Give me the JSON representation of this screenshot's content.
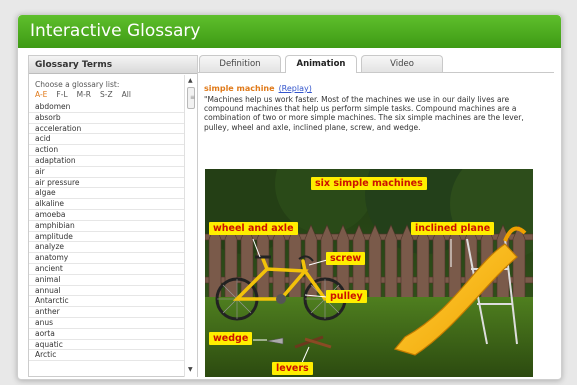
{
  "window": {
    "title": "Interactive Glossary"
  },
  "left_panel": {
    "header": "Glossary Terms",
    "choose_label": "Choose a glossary list:",
    "ranges": [
      "A-E",
      "F-L",
      "M-R",
      "S-Z",
      "All"
    ],
    "active_range": "A-E",
    "terms": [
      "abdomen",
      "absorb",
      "acceleration",
      "acid",
      "action",
      "adaptation",
      "air",
      "air pressure",
      "algae",
      "alkaline",
      "amoeba",
      "amphibian",
      "amplitude",
      "analyze",
      "anatomy",
      "ancient",
      "animal",
      "annual",
      "Antarctic",
      "anther",
      "anus",
      "aorta",
      "aquatic",
      "Arctic"
    ]
  },
  "tabs": [
    {
      "label": "Definition",
      "active": false
    },
    {
      "label": "Animation",
      "active": true
    },
    {
      "label": "Video",
      "active": false
    }
  ],
  "content": {
    "term": "simple machine",
    "replay": "(Replay)",
    "definition": "\"Machines help us work faster. Most of the machines we use in our daily lives are compound machines that help us perform simple tasks. Compound machines are a combination of two or more simple machines. The six simple machines are the lever, pulley, wheel and axle, inclined plane, screw, and wedge.",
    "animation_labels": {
      "title": "six simple machines",
      "wheel_and_axle": "wheel and axle",
      "inclined_plane": "inclined plane",
      "screw": "screw",
      "pulley": "pulley",
      "wedge": "wedge",
      "levers": "levers"
    }
  },
  "colors": {
    "titlebar": "#4aa81c",
    "accent_orange": "#e07a1a",
    "label_bg": "#ffee00",
    "label_text": "#cc1100"
  },
  "icons": [
    "scroll-up-icon",
    "scroll-down-icon",
    "scroll-grip-icon"
  ]
}
